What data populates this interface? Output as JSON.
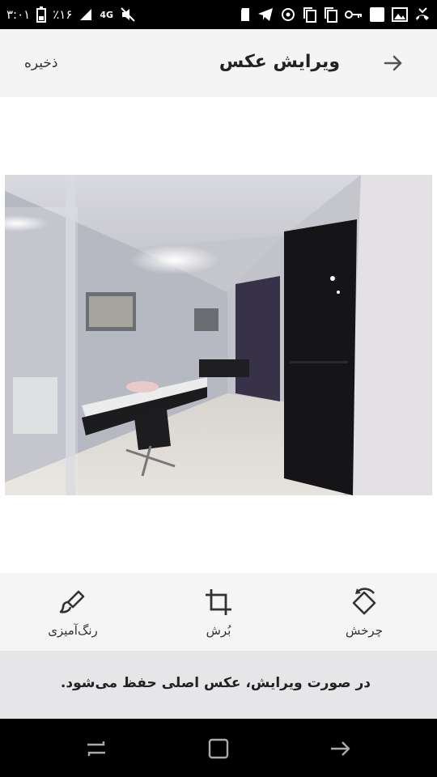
{
  "status_bar": {
    "time": "۳:۰۱",
    "battery": "٪۱۶",
    "network": "4G",
    "icons": [
      "battery-icon",
      "signal-icon",
      "network-4g-icon",
      "mute-icon",
      "sd-card-icon",
      "telegram-icon",
      "sync-icon",
      "copy-icon",
      "copy-icon",
      "key-icon",
      "square-icon",
      "image-icon",
      "missed-call-icon"
    ]
  },
  "app_bar": {
    "title": "ویرایش عکس",
    "save_label": "ذخیره",
    "back_icon": "arrow-right-icon"
  },
  "tools": [
    {
      "label": "رنگ‌آمیزی",
      "icon": "brush-icon"
    },
    {
      "label": "بُرش",
      "icon": "crop-icon"
    },
    {
      "label": "چرخش",
      "icon": "rotate-icon"
    }
  ],
  "notice": {
    "text": "در صورت ویرایش، عکس اصلی حفظ می‌شود."
  },
  "nav_bar": {
    "icons": [
      "recent-apps-icon",
      "home-icon",
      "back-icon"
    ]
  },
  "colors": {
    "status_bar_bg": "#000000",
    "app_bar_bg": "#f4f4f4",
    "tools_bg": "#f5f5f5",
    "notice_bg": "#e6e6e8",
    "nav_bar_bg": "#000000"
  }
}
